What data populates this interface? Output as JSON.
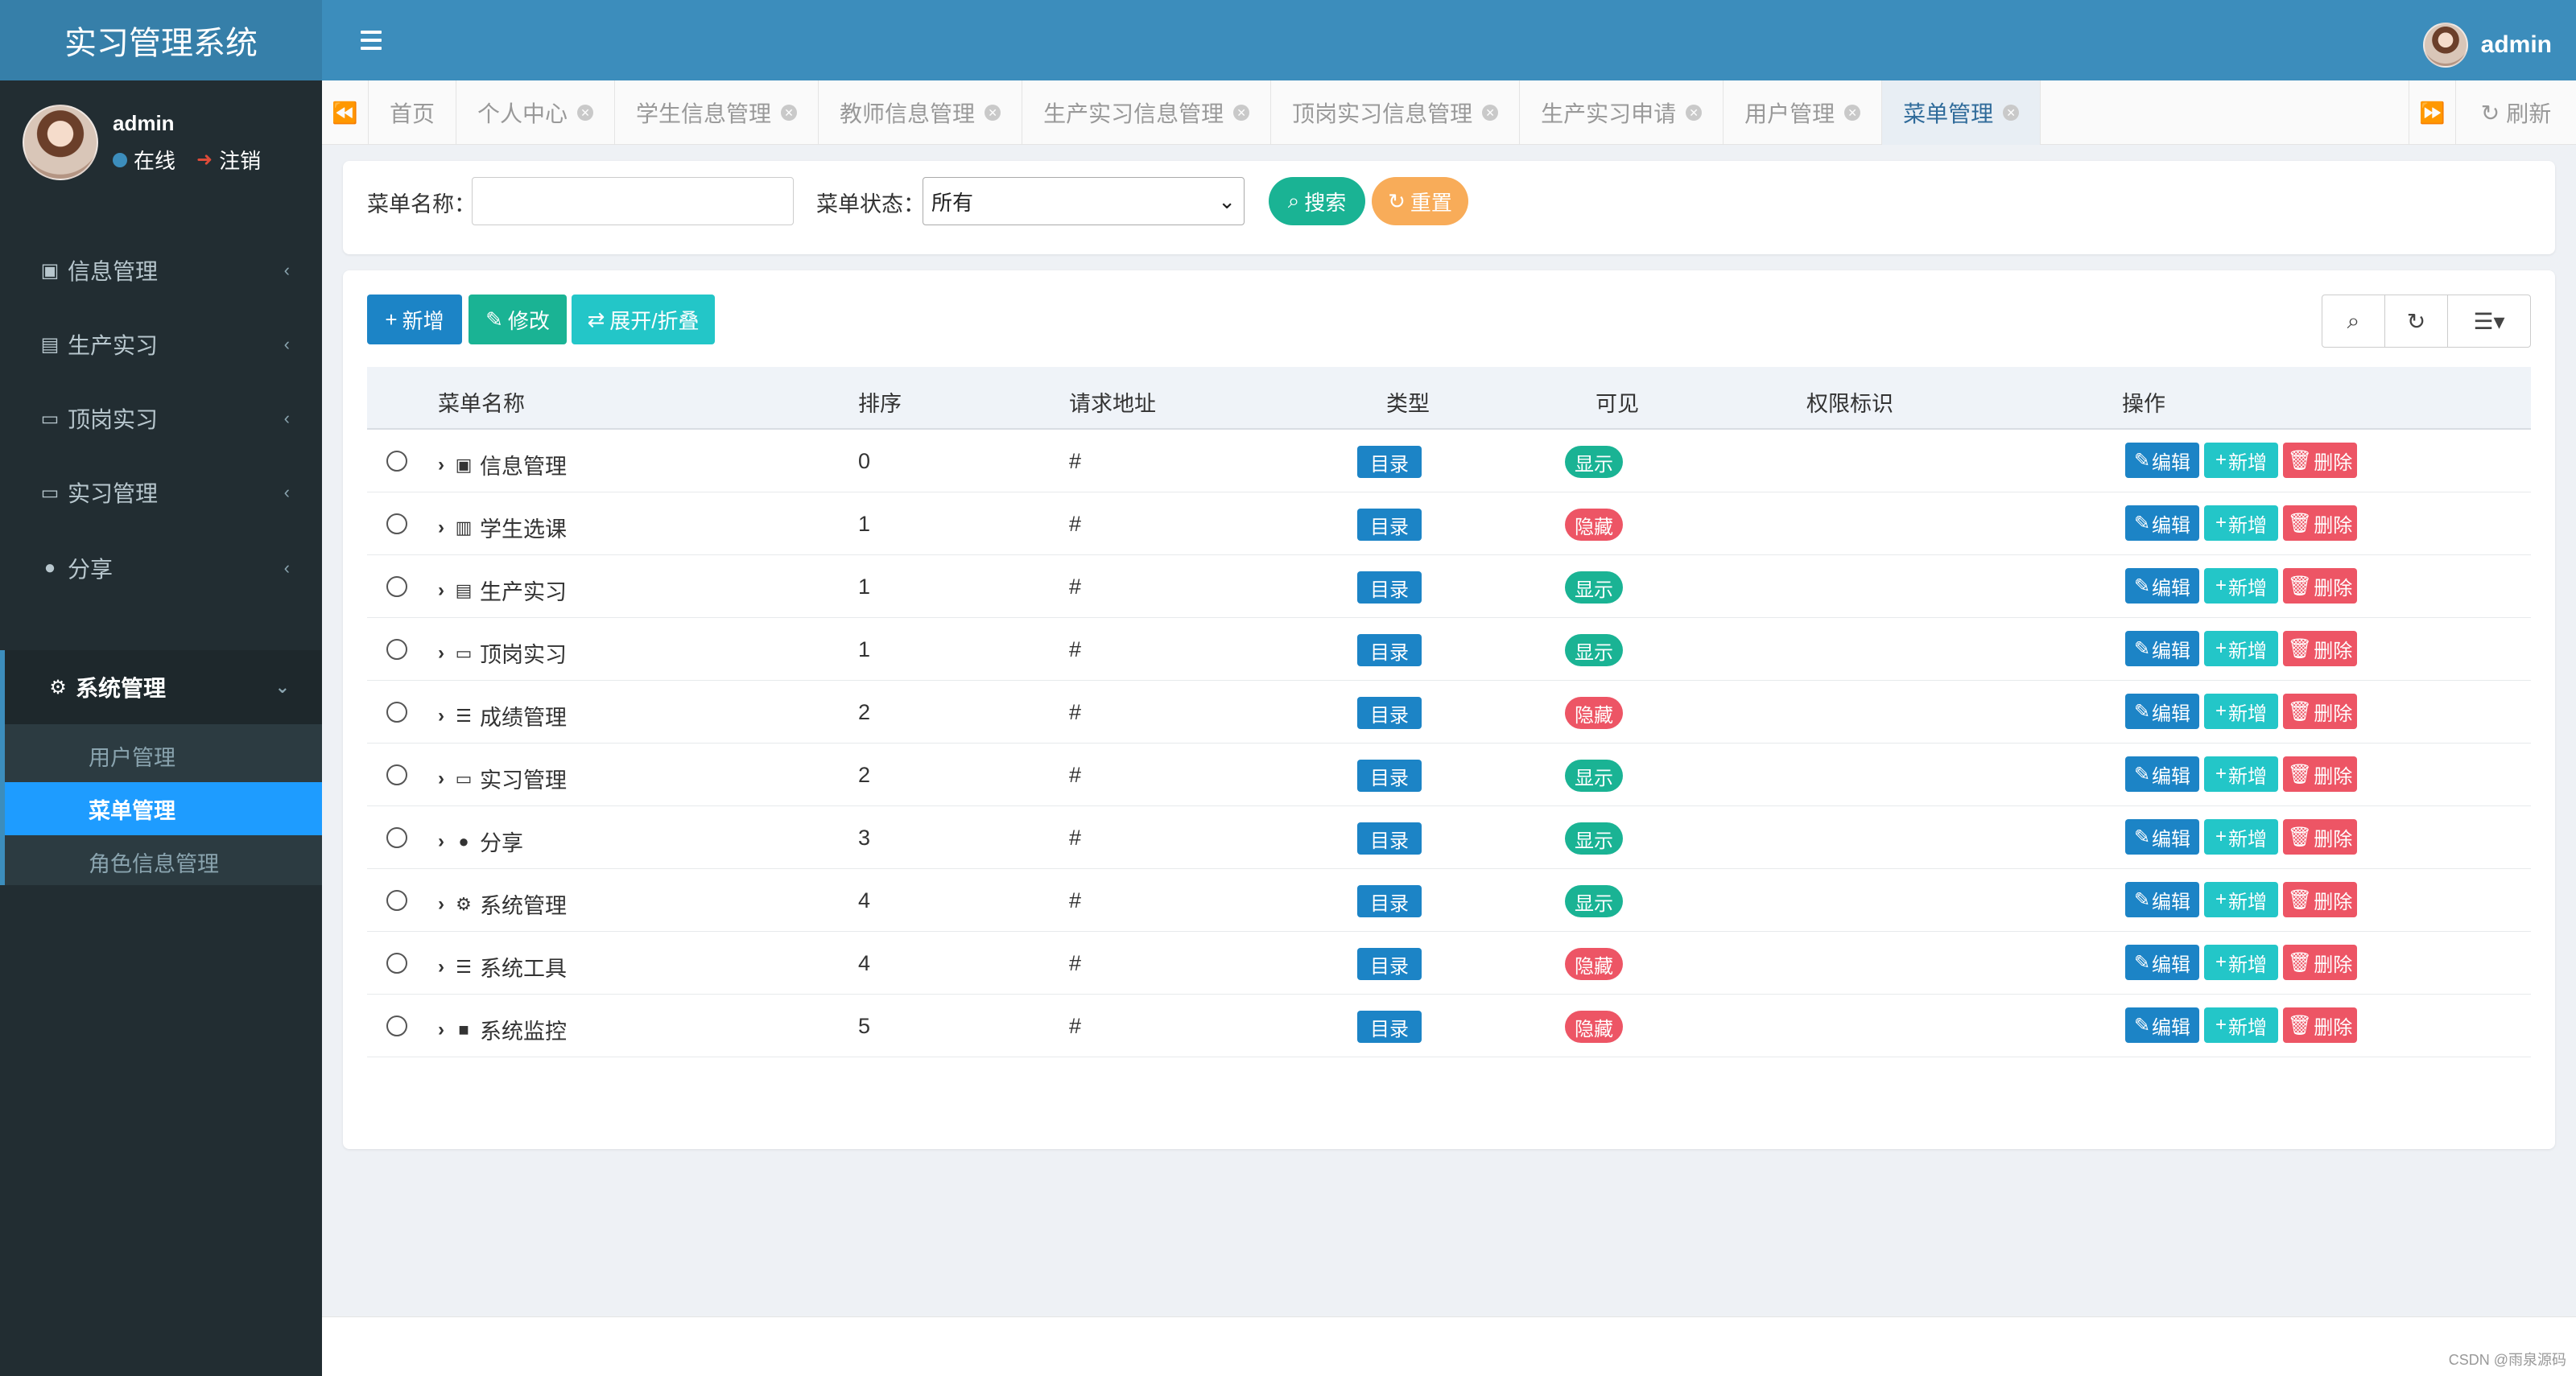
{
  "app": {
    "title": "实习管理系统"
  },
  "header": {
    "username": "admin"
  },
  "sidebar": {
    "user": {
      "name": "admin",
      "status": "在线",
      "logout": "注销"
    },
    "menus": [
      {
        "label": "信息管理",
        "icon": "address-book-icon"
      },
      {
        "label": "生产实习",
        "icon": "id-badge-icon"
      },
      {
        "label": "顶岗实习",
        "icon": "id-card-icon"
      },
      {
        "label": "实习管理",
        "icon": "vcard-icon"
      },
      {
        "label": "分享",
        "icon": "comment-icon"
      },
      {
        "label": "系统管理",
        "icon": "gear-icon"
      }
    ],
    "submenu": [
      {
        "label": "用户管理"
      },
      {
        "label": "菜单管理"
      },
      {
        "label": "角色信息管理"
      }
    ]
  },
  "tabs": [
    {
      "label": "首页"
    },
    {
      "label": "个人中心"
    },
    {
      "label": "学生信息管理"
    },
    {
      "label": "教师信息管理"
    },
    {
      "label": "生产实习信息管理"
    },
    {
      "label": "顶岗实习信息管理"
    },
    {
      "label": "生产实习申请"
    },
    {
      "label": "用户管理"
    },
    {
      "label": "菜单管理"
    }
  ],
  "tab_refresh": "刷新",
  "search": {
    "name_label": "菜单名称：",
    "name_value": "",
    "status_label": "菜单状态：",
    "status_value": "所有",
    "search_btn": "搜索",
    "reset_btn": "重置"
  },
  "toolbar": {
    "add": "新增",
    "edit": "修改",
    "expand": "展开/折叠"
  },
  "table": {
    "headers": [
      "菜单名称",
      "排序",
      "请求地址",
      "类型",
      "可见",
      "权限标识",
      "操作"
    ],
    "actions": {
      "edit": "编辑",
      "add": "新增",
      "delete": "删除"
    },
    "rows": [
      {
        "name": "信息管理",
        "icon": "address-book-icon",
        "order": "0",
        "url": "#",
        "type": "目录",
        "visible": "显示",
        "perm": ""
      },
      {
        "name": "学生选课",
        "icon": "bar-chart-icon",
        "order": "1",
        "url": "#",
        "type": "目录",
        "visible": "隐藏",
        "perm": ""
      },
      {
        "name": "生产实习",
        "icon": "id-badge-icon",
        "order": "1",
        "url": "#",
        "type": "目录",
        "visible": "显示",
        "perm": ""
      },
      {
        "name": "顶岗实习",
        "icon": "id-card-icon",
        "order": "1",
        "url": "#",
        "type": "目录",
        "visible": "显示",
        "perm": ""
      },
      {
        "name": "成绩管理",
        "icon": "list-icon",
        "order": "2",
        "url": "#",
        "type": "目录",
        "visible": "隐藏",
        "perm": ""
      },
      {
        "name": "实习管理",
        "icon": "vcard-icon",
        "order": "2",
        "url": "#",
        "type": "目录",
        "visible": "显示",
        "perm": ""
      },
      {
        "name": "分享",
        "icon": "comment-icon",
        "order": "3",
        "url": "#",
        "type": "目录",
        "visible": "显示",
        "perm": ""
      },
      {
        "name": "系统管理",
        "icon": "gear-icon",
        "order": "4",
        "url": "#",
        "type": "目录",
        "visible": "显示",
        "perm": ""
      },
      {
        "name": "系统工具",
        "icon": "list-icon",
        "order": "4",
        "url": "#",
        "type": "目录",
        "visible": "隐藏",
        "perm": ""
      },
      {
        "name": "系统监控",
        "icon": "video-camera-icon",
        "order": "5",
        "url": "#",
        "type": "目录",
        "visible": "隐藏",
        "perm": ""
      }
    ]
  },
  "footer": {
    "watermark": "CSDN @雨泉源码"
  },
  "colors": {
    "header": "#3c8dbc",
    "sidebar": "#222d32",
    "active_submenu": "#1e9cff",
    "primary": "#1c84c6",
    "success": "#1ab394",
    "info": "#23c6c8",
    "danger": "#ed5565",
    "warning": "#f8ac59"
  }
}
